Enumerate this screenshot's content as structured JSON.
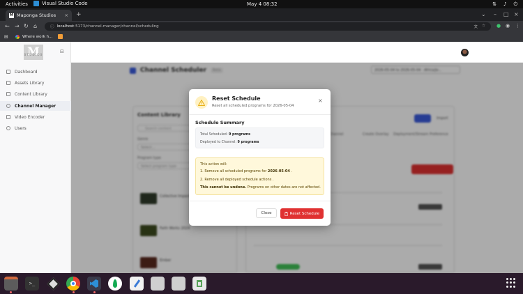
{
  "system_bar": {
    "activities": "Activities",
    "app_name": "Visual Studio Code",
    "clock": "May 4  08:32"
  },
  "browser": {
    "tab_title": "Maponga Studios",
    "url_host": "localhost",
    "url_path": ":5173/channel-manager/channel/scheduling",
    "bookmark_label": "Where work h..."
  },
  "sidebar": {
    "logo_text": "M",
    "logo_sub": "STUDIOS",
    "items": [
      {
        "label": "Dashboard",
        "icon": "home-icon"
      },
      {
        "label": "Assets Library",
        "icon": "folder-icon"
      },
      {
        "label": "Content Library",
        "icon": "library-icon"
      },
      {
        "label": "Channel Manager",
        "icon": "channel-icon"
      },
      {
        "label": "Video Encoder",
        "icon": "video-icon"
      },
      {
        "label": "Users",
        "icon": "users-icon"
      }
    ],
    "active_index": 3
  },
  "background": {
    "page_title": "Channel Scheduler",
    "badge": "Beta",
    "date_range": "2026-05-04 to 2026-05-04 · Africa/Jo...",
    "content_library_title": "Content Library",
    "search_placeholder": "Search content",
    "genre_label": "Genre",
    "genre_value": "Select...",
    "program_type_label": "Program type",
    "program_type_value": "Select program type",
    "items": [
      {
        "title": "Collective Impact",
        "color": "#2f3b2a"
      },
      {
        "title": "Faith Works 2024",
        "color": "#3d4b1f"
      },
      {
        "title": "Ember",
        "color": "#5a2a1f"
      }
    ],
    "blue_btn_text": "Add",
    "text_btn": "Import",
    "col_headers": [
      "Schedule",
      "Date",
      "Channel",
      "Create Overlay",
      "Deployment/Stream Preference"
    ],
    "colors": {
      "primary": "#3b5bdb",
      "danger": "#e03131",
      "success": "#40c057"
    }
  },
  "modal": {
    "title": "Reset Schedule",
    "subtitle": "Reset all scheduled programs for 2026-05-04",
    "summary_title": "Schedule Summary",
    "total_label": "Total Scheduled:",
    "total_value": "9 programs",
    "deployed_label": "Deployed to Channel:",
    "deployed_value": "9 programs",
    "action_intro": "This action will:",
    "action_1_prefix": "1. Remove all scheduled programs for",
    "action_1_date": "2026-05-04",
    "action_1_suffix": ".",
    "action_2": "2. Remove all deployed schedule actions .",
    "undo_bold": "This cannot be undone.",
    "undo_rest": " Programs on other dates are not affected.",
    "close_label": "Close",
    "reset_label": "Reset Schedule",
    "colors": {
      "warning_bg": "#fff8db",
      "danger": "#e03131"
    }
  },
  "taskbar": {
    "apps": [
      "files-icon",
      "terminal-icon",
      "box-icon",
      "chrome-icon",
      "vscode-icon",
      "mongodb-icon",
      "text-editor-icon",
      "drive-icon",
      "drive-icon",
      "trash-icon"
    ]
  }
}
